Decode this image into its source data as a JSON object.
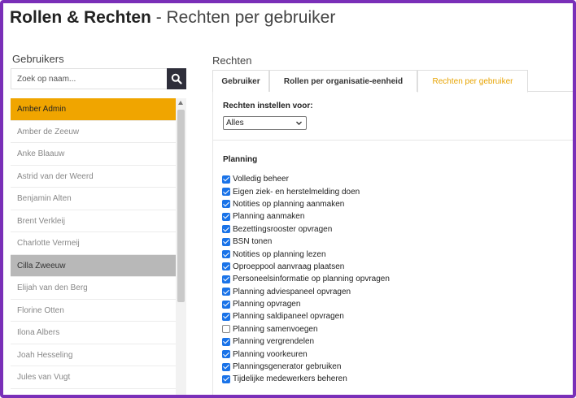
{
  "header": {
    "title_bold": "Rollen & Rechten",
    "title_rest": " - Rechten per gebruiker"
  },
  "users": {
    "heading": "Gebruikers",
    "search_placeholder": "Zoek op naam...",
    "items": [
      {
        "name": "Amber Admin",
        "state": "active"
      },
      {
        "name": "Amber de Zeeuw",
        "state": ""
      },
      {
        "name": "Anke Blaauw",
        "state": ""
      },
      {
        "name": "Astrid van der Weerd",
        "state": ""
      },
      {
        "name": "Benjamin Alten",
        "state": ""
      },
      {
        "name": "Brent Verkleij",
        "state": ""
      },
      {
        "name": "Charlotte Vermeij",
        "state": ""
      },
      {
        "name": "Cilla Zweeuw",
        "state": "hover"
      },
      {
        "name": "Elijah van den Berg",
        "state": ""
      },
      {
        "name": "Florine Otten",
        "state": ""
      },
      {
        "name": "Ilona Albers",
        "state": ""
      },
      {
        "name": "Joah Hesseling",
        "state": ""
      },
      {
        "name": "Jules van Vugt",
        "state": ""
      }
    ]
  },
  "rights": {
    "heading": "Rechten",
    "tabs": [
      {
        "label": "Gebruiker"
      },
      {
        "label": "Rollen per organisatie-eenheid"
      },
      {
        "label": "Rechten per gebruiker"
      }
    ],
    "set_for_label": "Rechten instellen voor:",
    "select_value": "Alles",
    "section_title": "Planning",
    "permissions": [
      {
        "label": "Volledig beheer",
        "checked": true
      },
      {
        "label": "Eigen ziek- en herstelmelding doen",
        "checked": true
      },
      {
        "label": "Notities op planning aanmaken",
        "checked": true
      },
      {
        "label": "Planning aanmaken",
        "checked": true
      },
      {
        "label": "Bezettingsrooster opvragen",
        "checked": true
      },
      {
        "label": "BSN tonen",
        "checked": true
      },
      {
        "label": "Notities op planning lezen",
        "checked": true
      },
      {
        "label": "Oproeppool aanvraag plaatsen",
        "checked": true
      },
      {
        "label": "Personeelsinformatie op planning opvragen",
        "checked": true
      },
      {
        "label": "Planning adviespaneel opvragen",
        "checked": true
      },
      {
        "label": "Planning opvragen",
        "checked": true
      },
      {
        "label": "Planning saldipaneel opvragen",
        "checked": true
      },
      {
        "label": "Planning samenvoegen",
        "checked": false
      },
      {
        "label": "Planning vergrendelen",
        "checked": true
      },
      {
        "label": "Planning voorkeuren",
        "checked": true
      },
      {
        "label": "Planningsgenerator gebruiken",
        "checked": true
      },
      {
        "label": "Tijdelijke medewerkers beheren",
        "checked": true
      }
    ]
  },
  "colors": {
    "frame": "#7a2fb8",
    "active_user": "#f0a500",
    "active_tab_text": "#e7a300",
    "checkbox": "#1a73e8"
  }
}
